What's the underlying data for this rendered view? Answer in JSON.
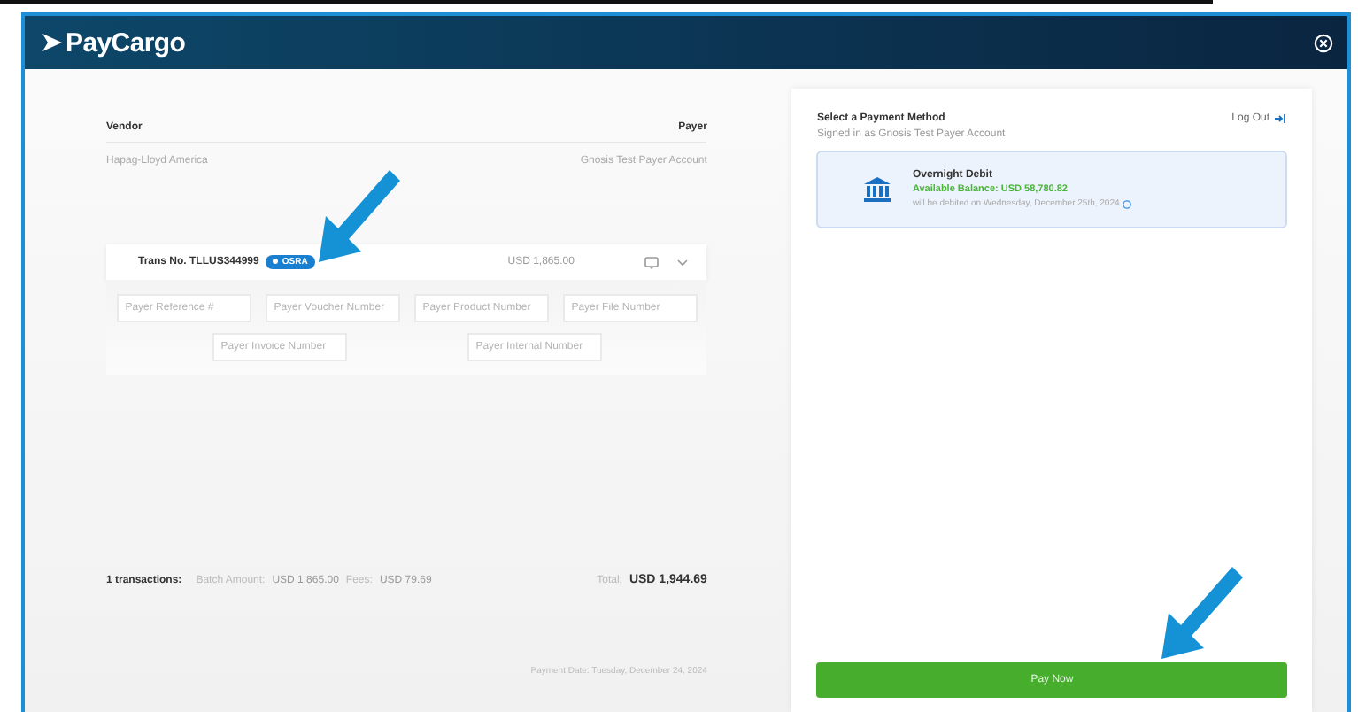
{
  "header": {
    "logo": "PayCargo"
  },
  "parties": {
    "vendor_label": "Vendor",
    "payer_label": "Payer",
    "vendor": "Hapag-Lloyd America",
    "payer": "Gnosis Test Payer Account"
  },
  "transaction": {
    "trans_no": "Trans No. TLLUS344999",
    "badge": "OSRA",
    "amount": "USD 1,865.00",
    "fields": [
      {
        "placeholder": "Payer Reference #"
      },
      {
        "placeholder": "Payer Voucher Number"
      },
      {
        "placeholder": "Payer Product Number"
      },
      {
        "placeholder": "Payer File Number"
      },
      {
        "placeholder": "Payer Invoice Number"
      },
      {
        "placeholder": "Payer Internal Number"
      }
    ]
  },
  "summary": {
    "count": "1 transactions:",
    "batch_label": "Batch Amount:",
    "batch": "USD 1,865.00",
    "fees_label": "Fees:",
    "fees": "USD 79.69",
    "total_label": "Total:",
    "total": "USD 1,944.69"
  },
  "payment_date": "Payment Date: Tuesday, December 24, 2024",
  "payment": {
    "title": "Select a Payment Method",
    "signed_in": "Signed in as Gnosis Test Payer Account",
    "logout": "Log Out",
    "methods": [
      {
        "name": "Overnight Debit",
        "balance": "Available Balance: USD 58,780.82",
        "note": "will be debited on Wednesday, December 25th, 2024",
        "selected": true
      }
    ]
  },
  "pay_button": "Pay Now"
}
